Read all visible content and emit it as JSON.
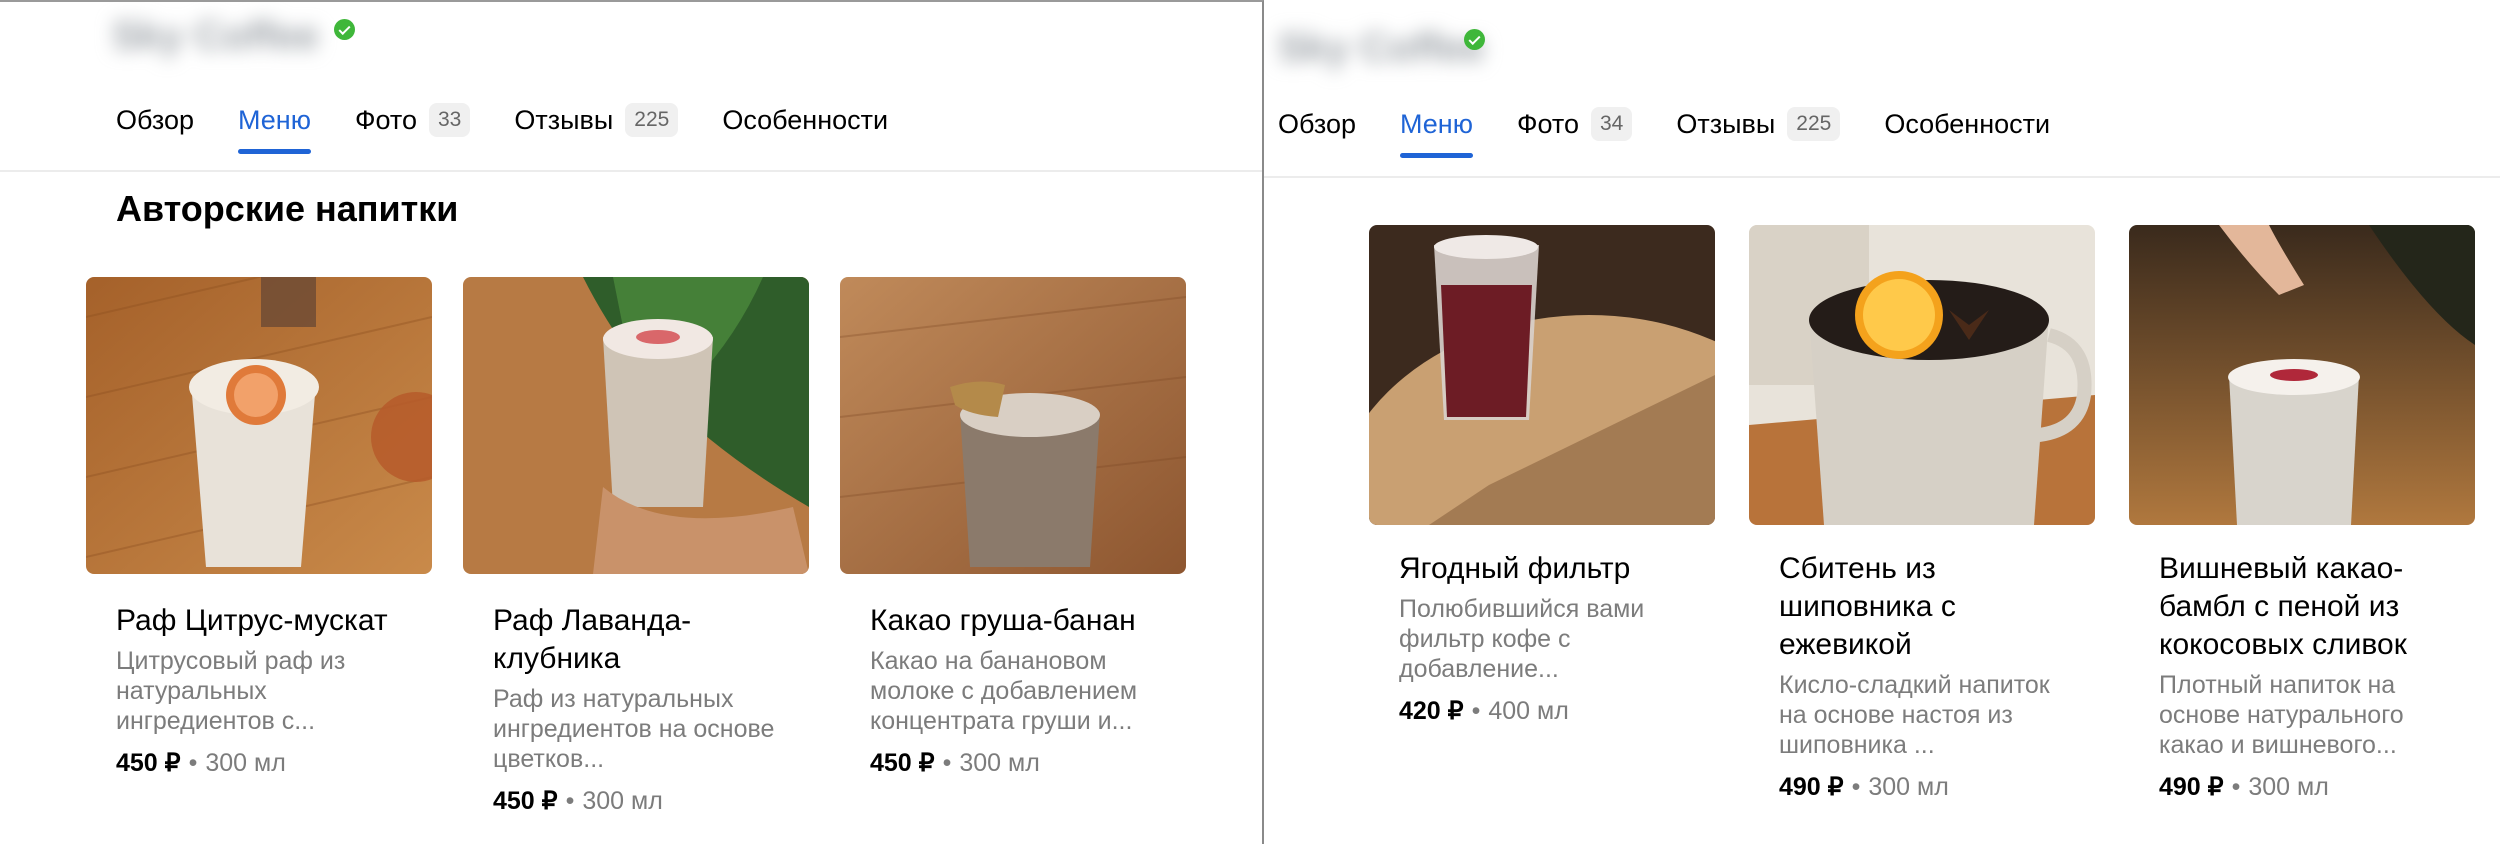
{
  "left": {
    "business_name": "Sky Coffee",
    "tabs": [
      {
        "label": "Обзор",
        "count": null
      },
      {
        "label": "Меню",
        "count": null
      },
      {
        "label": "Фото",
        "count": "33"
      },
      {
        "label": "Отзывы",
        "count": "225"
      },
      {
        "label": "Особенности",
        "count": null
      }
    ],
    "section_title": "Авторские напитки",
    "items": [
      {
        "name": "Раф Цитрус-мускат",
        "description": "Цитрусовый раф из натуральных ингредиентов с...",
        "price": "450 ₽",
        "separator": "•",
        "volume": "300 мл"
      },
      {
        "name": "Раф Лаванда-клубника",
        "description": "Раф из натуральных ингредиентов на основе цветков...",
        "price": "450 ₽",
        "separator": "•",
        "volume": "300 мл"
      },
      {
        "name": "Какао груша-банан",
        "description": "Какао на банановом молоке с добавлением концентрата груши и...",
        "price": "450 ₽",
        "separator": "•",
        "volume": "300 мл"
      }
    ]
  },
  "right": {
    "business_name": "Sky Coffee",
    "tabs": [
      {
        "label": "Обзор",
        "count": null
      },
      {
        "label": "Меню",
        "count": null
      },
      {
        "label": "Фото",
        "count": "34"
      },
      {
        "label": "Отзывы",
        "count": "225"
      },
      {
        "label": "Особенности",
        "count": null
      }
    ],
    "items": [
      {
        "name": "Ягодный фильтр",
        "description": "Полюбившийся вами фильтр кофе с добавление...",
        "price": "420 ₽",
        "separator": "•",
        "volume": "400 мл"
      },
      {
        "name": "Сбитень из шиповника с ежевикой",
        "description": "Кисло-сладкий напиток на основе настоя из шиповника ...",
        "price": "490 ₽",
        "separator": "•",
        "volume": "300 мл"
      },
      {
        "name": "Вишневый какао-бамбл с пеной из кокосовых сливок",
        "description": "Плотный напиток на основе натурального какао и вишневого...",
        "price": "490 ₽",
        "separator": "•",
        "volume": "300 мл"
      }
    ]
  },
  "colors": {
    "accent": "#1f64d6",
    "verified": "#3fb73a",
    "muted_text": "#7c7c7c"
  },
  "icons": {
    "verified": "verified-check-icon"
  }
}
